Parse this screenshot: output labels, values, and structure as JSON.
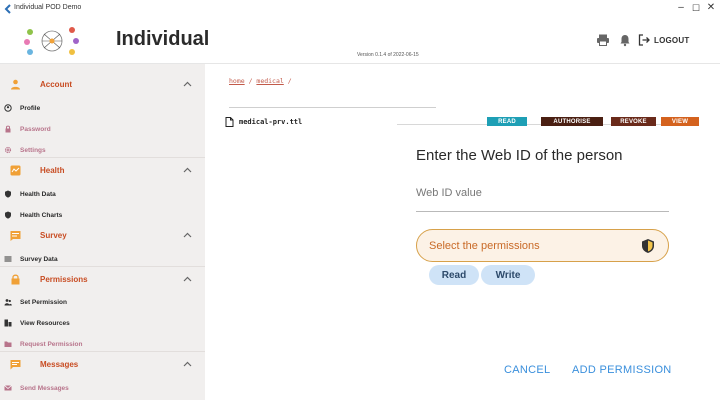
{
  "window": {
    "title": "Individual POD Demo",
    "controls": {
      "minimize": "–",
      "maximize": "☐",
      "close": "✕"
    }
  },
  "header": {
    "app_name": "Individual",
    "version": "Version 0.1.4 of 2022-06-15",
    "logout_label": "LOGOUT",
    "icons": [
      "print-icon",
      "bell-icon",
      "logout-icon"
    ]
  },
  "sidebar": {
    "sections": [
      {
        "label": "Account",
        "icon": "person-icon",
        "items": [
          {
            "label": "Profile",
            "icon": "profile-icon"
          },
          {
            "label": "Password",
            "icon": "lock-icon"
          },
          {
            "label": "Settings",
            "icon": "gear-icon"
          }
        ]
      },
      {
        "label": "Health",
        "icon": "health-icon",
        "items": [
          {
            "label": "Health Data",
            "icon": "shield-icon"
          },
          {
            "label": "Health Charts",
            "icon": "shield-icon"
          }
        ]
      },
      {
        "label": "Survey",
        "icon": "survey-icon",
        "items": [
          {
            "label": "Survey Data",
            "icon": "list-icon"
          }
        ]
      },
      {
        "label": "Permissions",
        "icon": "lock-icon",
        "items": [
          {
            "label": "Set Permission",
            "icon": "users-icon"
          },
          {
            "label": "View Resources",
            "icon": "resources-icon"
          },
          {
            "label": "Request Permission",
            "icon": "folder-icon"
          }
        ]
      },
      {
        "label": "Messages",
        "icon": "message-icon",
        "items": [
          {
            "label": "Send Messages",
            "icon": "mail-icon"
          }
        ]
      }
    ]
  },
  "main": {
    "breadcrumb": {
      "home": "home",
      "sep1": " / ",
      "medical": "medical",
      "sep2": " /"
    },
    "file": {
      "name": "medical-prv.ttl"
    },
    "actions": {
      "read": "READ",
      "authorise": "AUTHORISE",
      "revoke": "REVOKE",
      "view": "VIEW"
    },
    "colors": {
      "read": "#1e9fb5",
      "authorise": "#4a1f12",
      "revoke": "#6a2a1a",
      "view": "#d4621e"
    },
    "dialog": {
      "title": "Enter the Web ID of the person",
      "webid_placeholder": "Web ID value",
      "select_label": "Select the permissions",
      "chips": [
        "Read",
        "Write"
      ],
      "cancel": "CANCEL",
      "add": "ADD PERMISSION"
    }
  }
}
